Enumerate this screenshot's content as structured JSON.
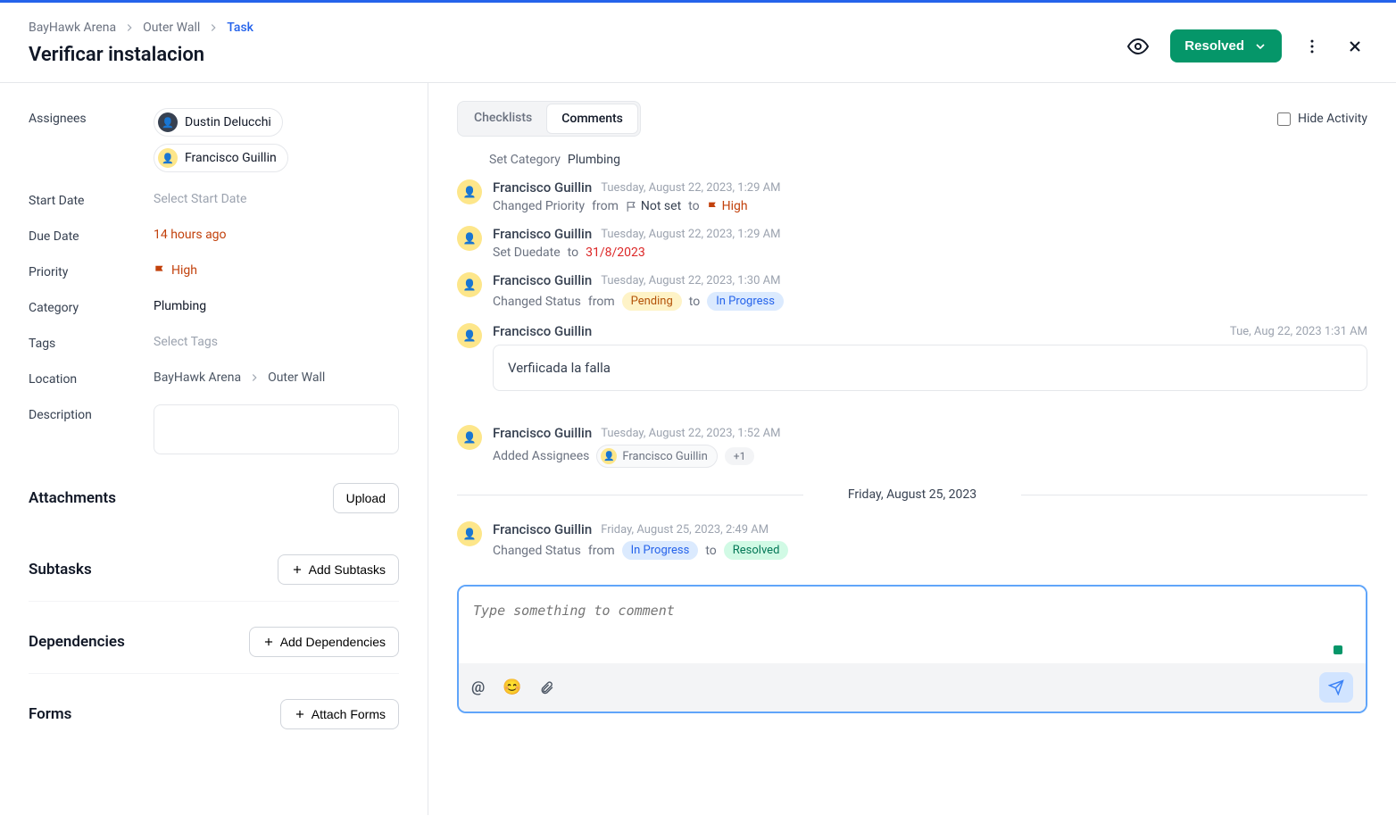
{
  "breadcrumbs": {
    "l1": "BayHawk Arena",
    "l2": "Outer Wall",
    "l3": "Task"
  },
  "page_title": "Verificar instalacion",
  "status_button": "Resolved",
  "left": {
    "labels": {
      "assignees": "Assignees",
      "start_date": "Start Date",
      "due_date": "Due Date",
      "priority": "Priority",
      "category": "Category",
      "tags": "Tags",
      "location": "Location",
      "description": "Description"
    },
    "assignees": [
      "Dustin Delucchi",
      "Francisco Guillin"
    ],
    "start_date_placeholder": "Select Start Date",
    "due_date": "14 hours ago",
    "priority": "High",
    "category_value": "Plumbing",
    "tags_placeholder": "Select Tags",
    "location": {
      "l1": "BayHawk Arena",
      "l2": "Outer Wall"
    },
    "sections": {
      "attachments": {
        "title": "Attachments",
        "btn": "Upload"
      },
      "subtasks": {
        "title": "Subtasks",
        "btn": "Add Subtasks"
      },
      "dependencies": {
        "title": "Dependencies",
        "btn": "Add Dependencies"
      },
      "forms": {
        "title": "Forms",
        "btn": "Attach Forms"
      }
    }
  },
  "right": {
    "tabs": {
      "checklists": "Checklists",
      "comments": "Comments"
    },
    "hide_activity": "Hide Activity",
    "activities": {
      "set_category": {
        "label": "Set Category",
        "value": "Plumbing"
      },
      "priority": {
        "name": "Francisco Guillin",
        "time": "Tuesday, August 22, 2023, 1:29 AM",
        "label": "Changed Priority",
        "from": "from",
        "not_set": "Not set",
        "to": "to",
        "high": "High"
      },
      "duedate": {
        "name": "Francisco Guillin",
        "time": "Tuesday, August 22, 2023, 1:29 AM",
        "label1": "Set Duedate",
        "to": "to",
        "value": "31/8/2023"
      },
      "status1": {
        "name": "Francisco Guillin",
        "time": "Tuesday, August 22, 2023, 1:30 AM",
        "label": "Changed Status",
        "from": "from",
        "pending": "Pending",
        "to": "to",
        "inprogress": "In Progress"
      },
      "comment1": {
        "name": "Francisco Guillin",
        "time": "Tue, Aug 22, 2023 1:31 AM",
        "text": "Verfiicada la falla"
      },
      "assignees_added": {
        "name": "Francisco Guillin",
        "time": "Tuesday, August 22, 2023, 1:52 AM",
        "label": "Added Assignees",
        "chip": "Francisco Guillin",
        "plus": "+1"
      },
      "divider": "Friday, August 25, 2023",
      "status2": {
        "name": "Francisco Guillin",
        "time": "Friday, August 25, 2023, 2:49 AM",
        "label": "Changed Status",
        "from": "from",
        "inprogress": "In Progress",
        "to": "to",
        "resolved": "Resolved"
      }
    },
    "composer_placeholder": "Type something to comment"
  }
}
